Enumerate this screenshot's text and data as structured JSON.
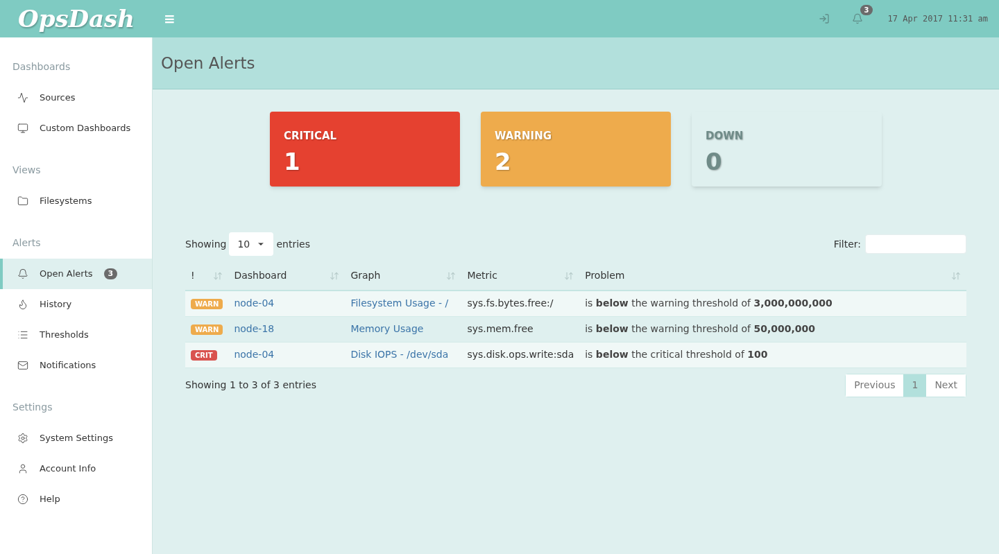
{
  "header": {
    "logo": "OpsDash",
    "menu_glyph": "≡",
    "notification_count": "3",
    "datetime": "17 Apr 2017 11:31 am"
  },
  "sidebar": [
    {
      "title": "Dashboards",
      "items": [
        {
          "label": "Sources",
          "selected": false
        },
        {
          "label": "Custom Dashboards",
          "selected": false
        }
      ]
    },
    {
      "title": "Views",
      "items": [
        {
          "label": "Filesystems",
          "selected": false
        }
      ]
    },
    {
      "title": "Alerts",
      "items": [
        {
          "label": "Open Alerts",
          "selected": true,
          "badge": "3"
        },
        {
          "label": "History",
          "selected": false
        },
        {
          "label": "Thresholds",
          "selected": false
        },
        {
          "label": "Notifications",
          "selected": false
        }
      ]
    },
    {
      "title": "Settings",
      "items": [
        {
          "label": "System Settings",
          "selected": false
        },
        {
          "label": "Account Info",
          "selected": false
        },
        {
          "label": "Help",
          "selected": false
        }
      ]
    }
  ],
  "page_title": "Open Alerts",
  "cards": [
    {
      "label": "CRITICAL",
      "value": "1",
      "color": "#e54130"
    },
    {
      "label": "WARNING",
      "value": "2",
      "color": "#eeab4c"
    },
    {
      "label": "DOWN",
      "value": "0",
      "color": "#dff0ef"
    }
  ],
  "table": {
    "length_prefix": "Showing",
    "length_value": "10",
    "length_suffix": "entries",
    "filter_label": "Filter:",
    "columns": [
      "!",
      "Dashboard",
      "Graph",
      "Metric",
      "Problem"
    ],
    "rows": [
      {
        "severity": "WARN",
        "color": "#eeab4c",
        "dashboard": "node-04",
        "graph": "Filesystem Usage - /",
        "metric": "sys.fs.bytes.free:/",
        "problem": "is **below** the warning threshold of **3,000,000,000**"
      },
      {
        "severity": "WARN",
        "color": "#eeab4c",
        "dashboard": "node-18",
        "graph": "Memory Usage",
        "metric": "sys.mem.free",
        "problem": "is **below** the warning threshold of **50,000,000**"
      },
      {
        "severity": "CRIT",
        "color": "#d9534f",
        "dashboard": "node-04",
        "graph": "Disk IOPS - /dev/sda",
        "metric": "sys.disk.ops.write:sda",
        "problem": "is **below** the critical threshold of **100**"
      }
    ],
    "info": "Showing 1 to 3 of 3 entries",
    "pages": [
      {
        "label": "Previous",
        "selected": false
      },
      {
        "label": "1",
        "selected": true
      },
      {
        "label": "Next",
        "selected": false
      }
    ]
  }
}
